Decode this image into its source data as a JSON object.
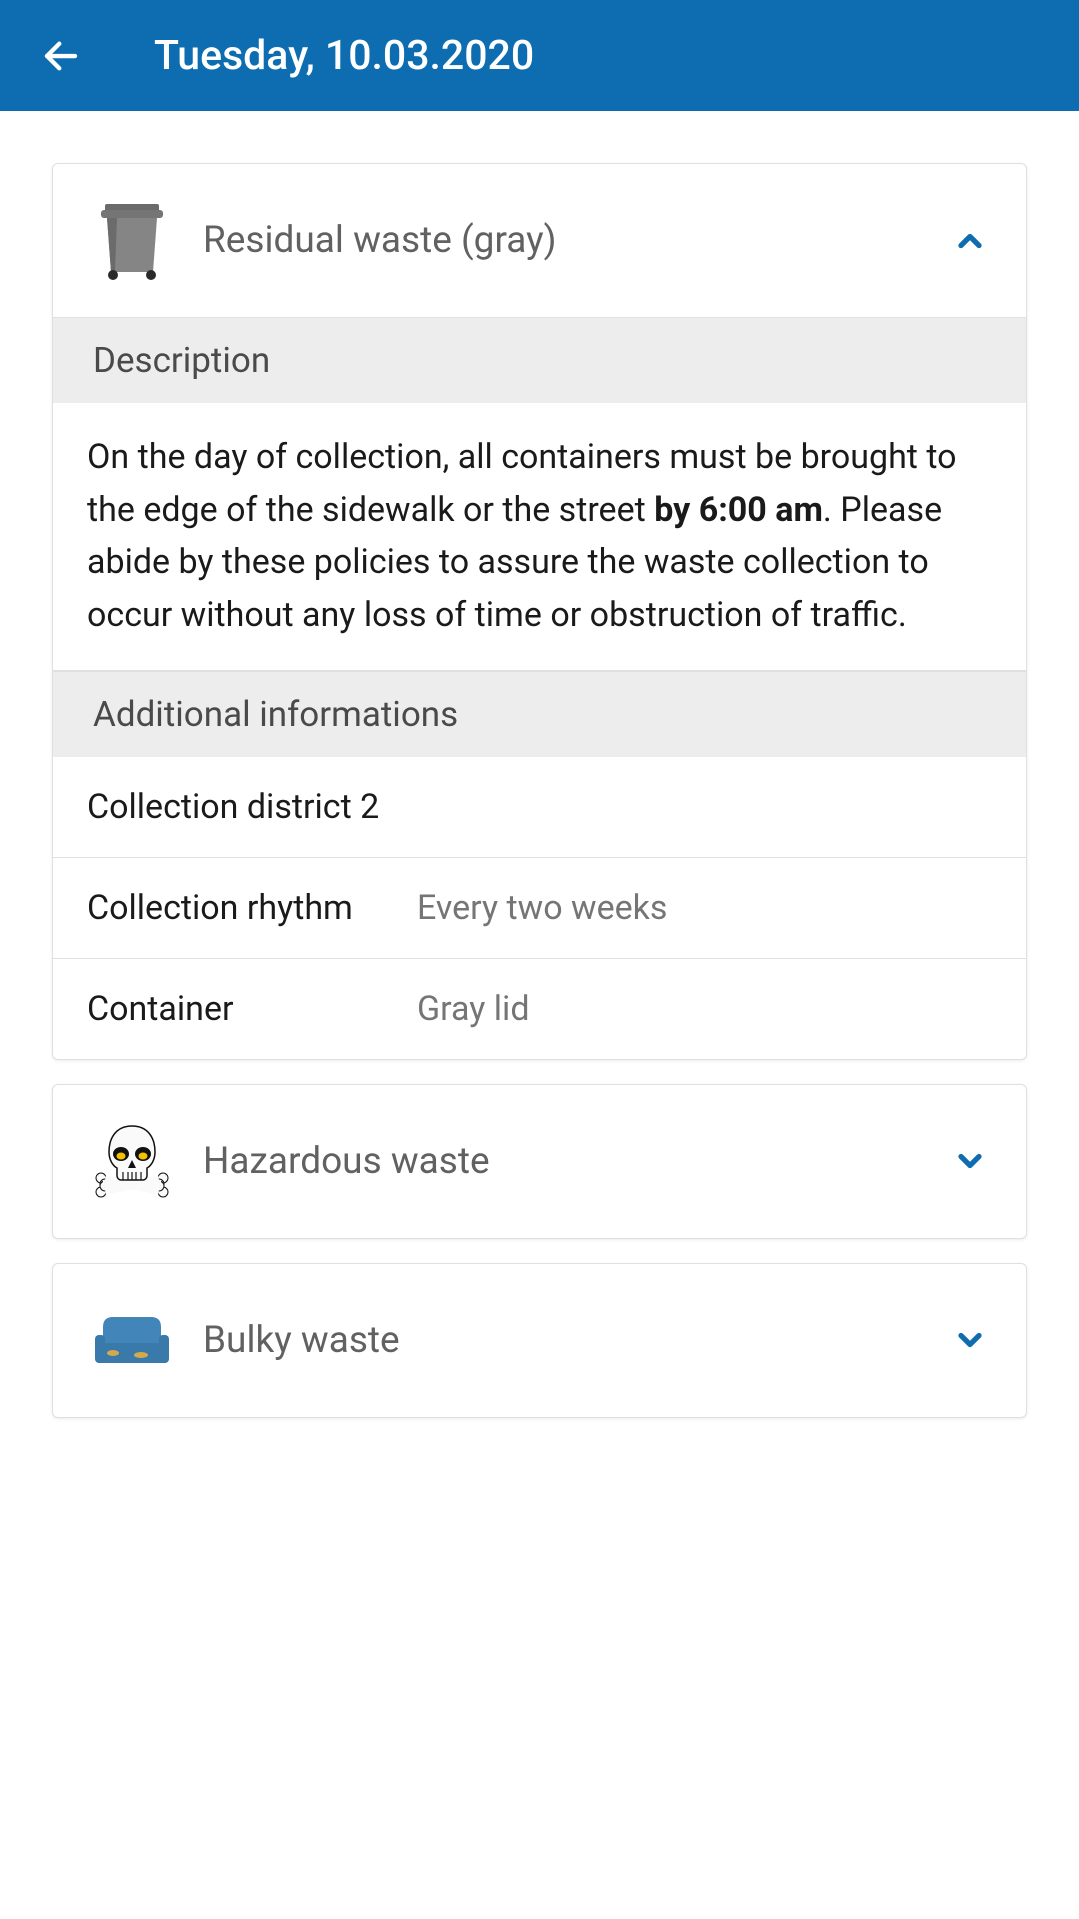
{
  "header": {
    "title": "Tuesday, 10.03.2020"
  },
  "cards": {
    "residual": {
      "title": "Residual waste (gray)",
      "expanded": true,
      "sections": {
        "description": {
          "header": "Description",
          "text_before": "On the day of collection, all containers must be brought to the edge of the sidewalk or the street ",
          "text_bold": "by 6:00 am",
          "text_after": ". Please abide by these policies to assure the waste collection to occur without any loss of time or obstruction of traffic."
        },
        "additional": {
          "header": "Additional informations",
          "district": "Collection district 2",
          "rhythm_label": "Collection rhythm",
          "rhythm_value": "Every two weeks",
          "container_label": "Container",
          "container_value": "Gray lid"
        }
      }
    },
    "hazardous": {
      "title": "Hazardous waste",
      "expanded": false
    },
    "bulky": {
      "title": "Bulky waste",
      "expanded": false
    }
  }
}
